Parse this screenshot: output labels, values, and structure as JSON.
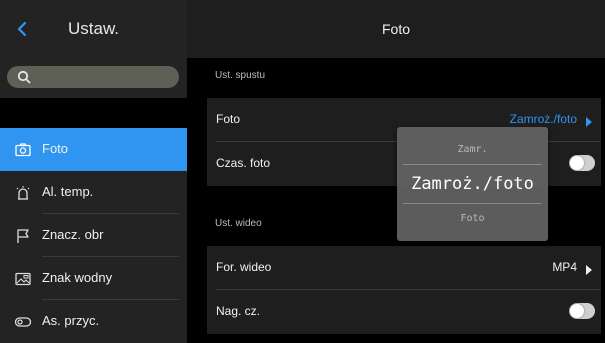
{
  "sidebar": {
    "title": "Ustaw.",
    "search": {
      "placeholder": ""
    },
    "items": [
      {
        "label": "Foto",
        "icon": "camera-icon",
        "active": true
      },
      {
        "label": "Al. temp.",
        "icon": "alarm-icon",
        "active": false
      },
      {
        "label": "Znacz. obr",
        "icon": "flag-icon",
        "active": false
      },
      {
        "label": "Znak wodny",
        "icon": "watermark-icon",
        "active": false
      },
      {
        "label": "As. przyc.",
        "icon": "toggle-icon",
        "active": false
      }
    ]
  },
  "main": {
    "title": "Foto",
    "sections": [
      {
        "label": "Ust. spustu",
        "rows": [
          {
            "label": "Foto",
            "value": "Zamroż./foto",
            "type": "select"
          },
          {
            "label": "Czas. foto",
            "type": "toggle",
            "on": false
          }
        ]
      },
      {
        "label": "Ust. wideo",
        "rows": [
          {
            "label": "For. wideo",
            "value": "MP4",
            "type": "select"
          },
          {
            "label": "Nag. cz.",
            "type": "toggle",
            "on": false
          }
        ]
      }
    ]
  },
  "picker": {
    "options": [
      "Zamr.",
      "Zamroż./foto",
      "Foto"
    ],
    "selected": "Zamroż./foto"
  },
  "colors": {
    "accent": "#2f95f0",
    "sidebar_bg": "#232323",
    "row_bg": "#1e1e1e",
    "background": "#000000"
  }
}
